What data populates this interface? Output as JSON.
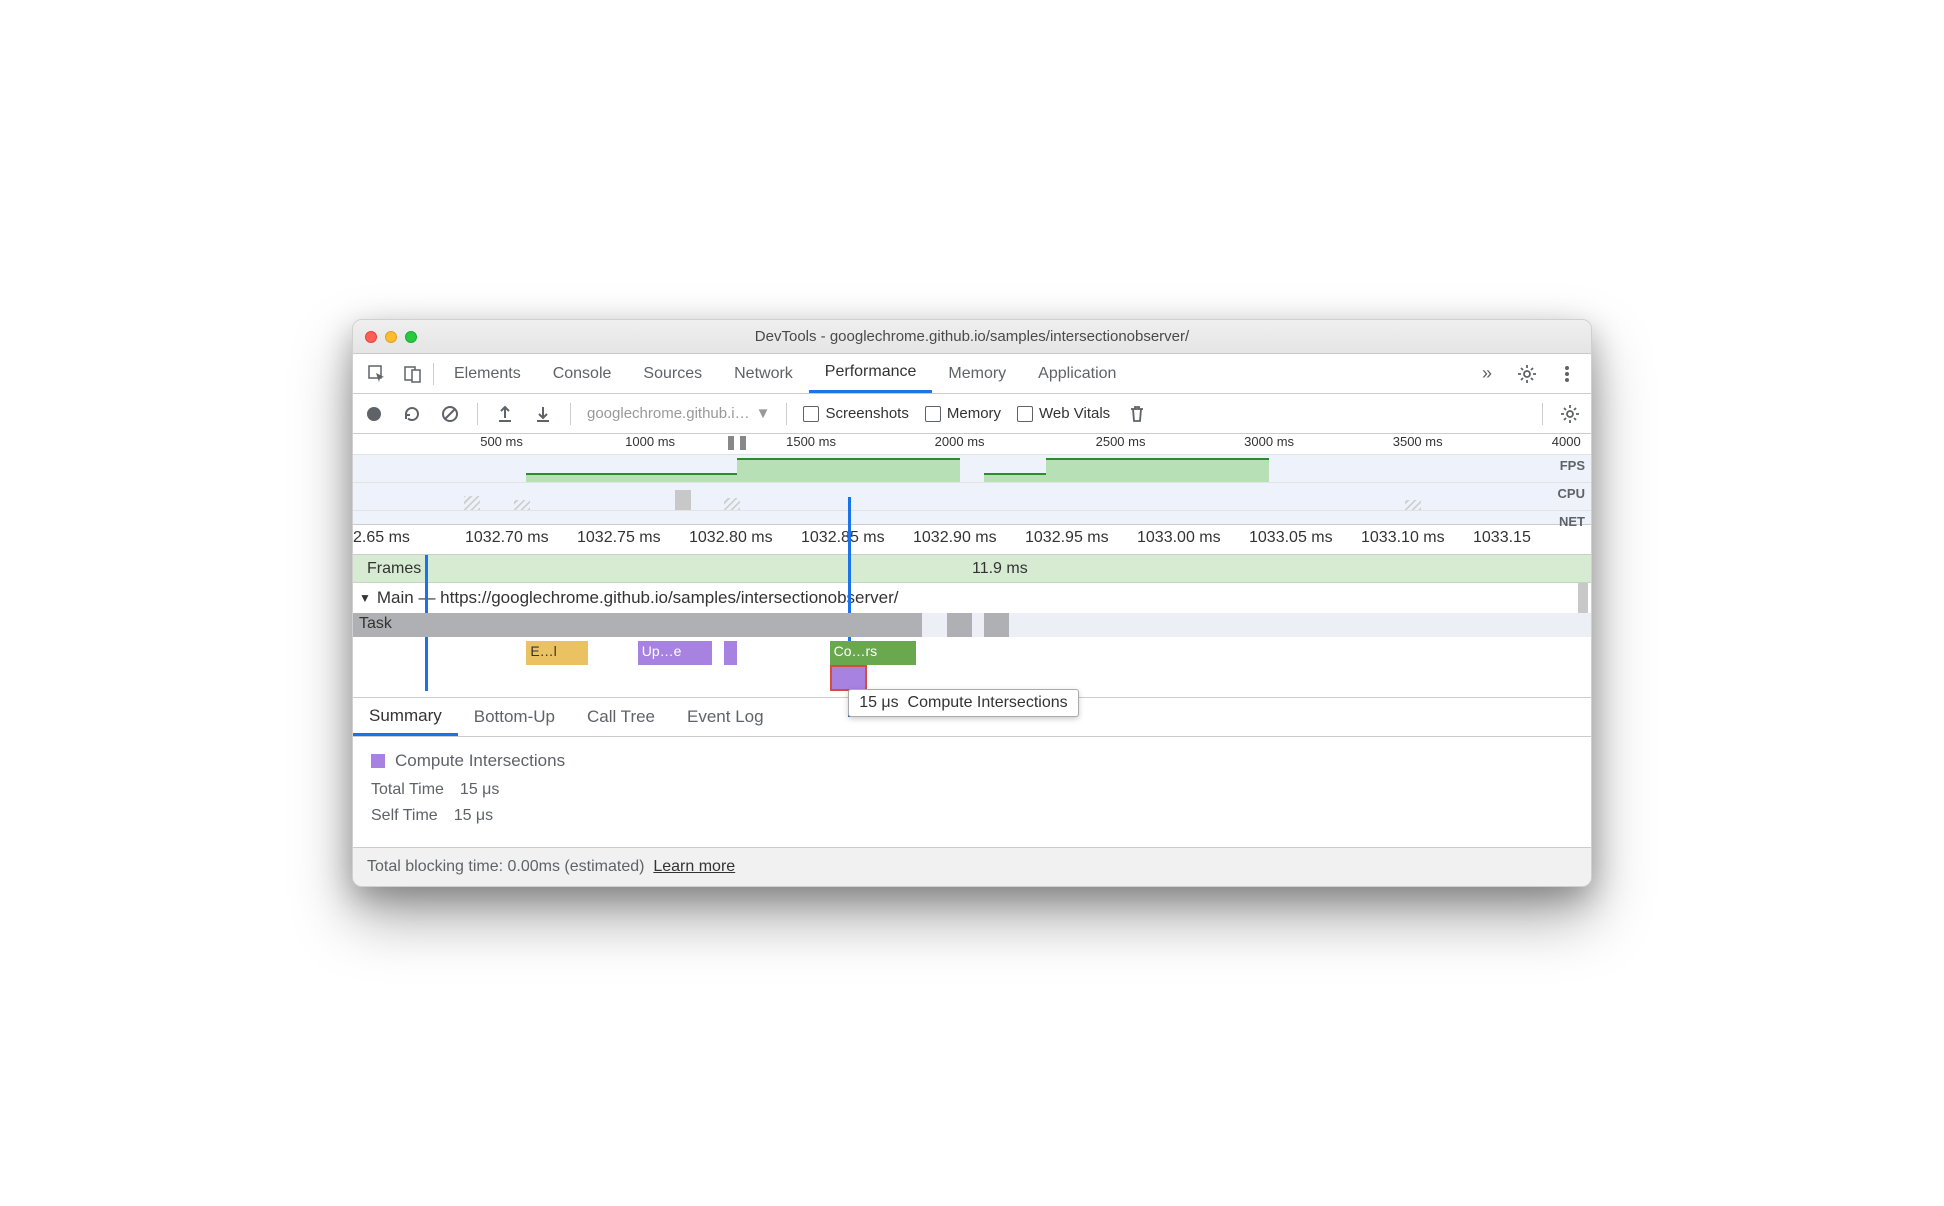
{
  "window": {
    "title": "DevTools - googlechrome.github.io/samples/intersectionobserver/"
  },
  "tabs": {
    "items": [
      "Elements",
      "Console",
      "Sources",
      "Network",
      "Performance",
      "Memory",
      "Application"
    ],
    "active": 4
  },
  "subbar": {
    "dropdown": "googlechrome.github.i…",
    "checks": {
      "screenshots": "Screenshots",
      "memory": "Memory",
      "webvitals": "Web Vitals"
    }
  },
  "overview": {
    "ticks": [
      "500 ms",
      "1000 ms",
      "1500 ms",
      "2000 ms",
      "2500 ms",
      "3000 ms",
      "3500 ms",
      "4000 ms"
    ],
    "lanes": {
      "fps": "FPS",
      "cpu": "CPU",
      "net": "NET"
    }
  },
  "ruler": [
    "2.65 ms",
    "1032.70 ms",
    "1032.75 ms",
    "1032.80 ms",
    "1032.85 ms",
    "1032.90 ms",
    "1032.95 ms",
    "1033.00 ms",
    "1033.05 ms",
    "1033.10 ms",
    "1033.15"
  ],
  "frames": {
    "label": "Frames",
    "value": "11.9 ms"
  },
  "main": {
    "header": "Main — https://googlechrome.github.io/samples/intersectionobserver/",
    "task": "Task",
    "blocks": {
      "e": "E…l",
      "up": "Up…e",
      "co": "Co…rs"
    },
    "tooltip": {
      "time": "15 μs",
      "name": "Compute Intersections"
    }
  },
  "details": {
    "tabs": [
      "Summary",
      "Bottom-Up",
      "Call Tree",
      "Event Log"
    ],
    "active": 0,
    "summary": {
      "name": "Compute Intersections",
      "total_label": "Total Time",
      "total_value": "15 μs",
      "self_label": "Self Time",
      "self_value": "15 μs"
    }
  },
  "footer": {
    "text": "Total blocking time: 0.00ms (estimated)",
    "link": "Learn more"
  }
}
